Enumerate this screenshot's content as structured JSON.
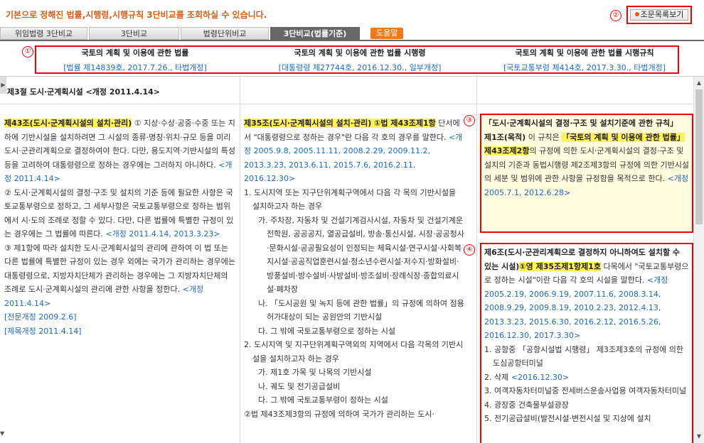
{
  "info_text": "기본으로 정해진 법률,시행령,시행규칙 3단비교를 조회하실 수 있습니다.",
  "markers": {
    "m1": "①",
    "m2": "②",
    "m3": "③",
    "m4": "④"
  },
  "list_button": "조문목록보기",
  "tabs": [
    "위임법령 3단비교",
    "3단비교",
    "법령단위비교",
    "3단비교(법률기준)"
  ],
  "help_button": "도움말",
  "headers": [
    {
      "title": "국토의 계획 및 이용에 관한 법률",
      "sub": "[법률 제14839호, 2017.7.26., 타법개정]"
    },
    {
      "title": "국토의 계획 및 이용에 관한 법률 시행령",
      "sub": "[대통령령 제27744호, 2016.12.30., 일부개정]"
    },
    {
      "title": "국토의 계획 및 이용에 관한 법률 시행규칙",
      "sub": "[국토교통부령 제414호, 2017.3.30., 타법개정]"
    }
  ],
  "section_title": "제3절 도시·군계획시설 <개정 2011.4.14>",
  "law": {
    "article_title": "제43조(도시·군계획시설의 설치·관리)",
    "p1": " ① 지상·수상·공중·수중 또는 지하에 기반시설을 설치하려면 그 시설의 종류·명칭·위치·규모 등을 미리 도시·군관리계획으로 결정하여야 한다. 다만, 용도지역·기반시설의 특성 등을 고려하여 대통령령으로 정하는 경우에는 그러하지 아니하다.",
    "p1_rev": "<개정 2011.4.14>",
    "p2": "② 도시·군계획시설의 결정·구조 및 설치의 기준 등에 필요한 사항은 국토교통부령으로 정하고, 그 세부사항은 국토교통부령으로 정하는 범위에서 시·도의 조례로 정할 수 있다. 다만, 다른 법률에 특별한 규정이 있는 경우에는 그 법률에 따른다.",
    "p2_rev": "<개정 2011.4.14, 2013.3.23>",
    "p3": "③ 제1항에 따라 설치한 도시·군계획시설의 관리에 관하여 이 법 또는 다른 법률에 특별한 규정이 있는 경우 외에는 국가가 관리하는 경우에는 대통령령으로, 지방자치단체가 관리하는 경우에는 그 지방자치단체의 조례로 도시·군계획시설의 관리에 관한 사항을 정한다.",
    "p3_rev": "<개정 2011.4.14>",
    "note1": "[전문개정 2009.2.6]",
    "note2": "[제목개정 2011.4.14]"
  },
  "decree": {
    "article_title": "제35조(도시·군계획시설의 설치·관리)",
    "ref": " ①법 제43조제1항",
    "intro": " 단서에서 \"대통령령으로 정하는 경우\"란 다음 각 호의 경우를 말한다.",
    "intro_rev": "<개정 2005.9.8, 2005.11.11, 2008.2.29, 2009.11.2, 2013.3.23, 2013.6.11, 2015.7.6, 2016.2.11, 2016.12.30>",
    "item1": "1. 도시지역 또는 지구단위계획구역에서 다음 각 목의 기반시설을 설치하고자 하는 경우",
    "item1a": "가. 주차장, 자동차 및 건설기계검사시설, 자동차 및 건설기계운전학원, 공공공지, 열공급설비, 방송·통신시설, 시장·공공청사·문화시설·공공필요성이 인정되는 체육시설·연구시설·사회복지시설·공공직업훈련시설·청소년수련시설·저수지·방화설비·방풍설비·방수설비·사방설비·방조설비·장례식장·종합의료시설·폐차장",
    "item1b": "나. 「도시공원 및 녹지 등에 관한 법률」의 규정에 의하여 점용허가대상이 되는 공원안의 기반시설",
    "item1c": "다. 그 밖에 국토교통부령으로 정하는 시설",
    "item2": "2. 도시지역 및 지구단위계획구역외의 지역에서 다음 각목의 기반시설을 설치하고자 하는 경우",
    "item2a": "가. 제1호 가목 및 나목의 기반시설",
    "item2b": "나. 궤도 및 전기공급설비",
    "item2c": "다. 그 밖에 국토교통부령이 정하는 시설",
    "p2": "②법 제43조제3항의 규정에 의하여 국가가 관리하는 도시·"
  },
  "rule": {
    "box3_title": "「도시·군계획시설의 결정·구조 및 설치기준에 관한 규칙」",
    "a1_title": "제1조(목적)",
    "a1_pre": " 이 규칙은 ",
    "a1_ref": "「국토의 계획 및 이용에 관한 법률」 제43조제2항",
    "a1_post": "의 규정에 의한 도시·군계획시설의 결정·구조 및 설치의 기준과 동법시행령 제2조제3항의 규정에 의한 기반시설의 세분 및 범위에 관한 사항을 규정함을 목적으로 한다.",
    "a1_rev": "<개정 2005.7.1, 2012.6.28>",
    "a6_title": "제6조(도시·군관리계획으로 결정하지 아니하여도 설치할 수 있는 시설)",
    "a6_ref": "①영 제35조제1항제1호",
    "a6_post": " 다목에서 \"국토교통부령으로 정하는 시설\"이란 다음 각 호의 시설을 말한다.",
    "a6_rev": "<개정 2005.2.19, 2006.9.19, 2007.11.6, 2008.3.14, 2008.9.29, 2009.8.19, 2010.2.23, 2012.4.13, 2013.3.23, 2015.6.30, 2016.2.12, 2016.5.26, 2016.12.30, 2017.3.30>",
    "i1": "1. 공항중 「공항시설법 시행령」 제3조제3호의 규정에 의한 도심공항터미널",
    "i2": "2. 삭제",
    "i2_rev": "<2016.12.30>",
    "i3": "3. 여객자동차터미널중 전세버스운송사업용 여객자동차터미널",
    "i4": "4. 광장중 건축물부설광장",
    "i5": "5. 전기공급설비(발전시설·변전시설 및 지상에 설치"
  }
}
